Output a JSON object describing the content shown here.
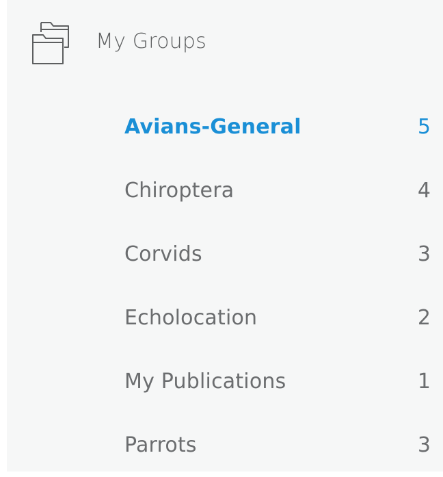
{
  "header": {
    "icon": "folders-icon",
    "title": "My Groups"
  },
  "colors": {
    "accent": "#1a8fd6",
    "text": "#6b6d6f",
    "background": "#f6f7f7"
  },
  "groups": [
    {
      "name": "Avians-General",
      "count": "5",
      "active": true
    },
    {
      "name": "Chiroptera",
      "count": "4",
      "active": false
    },
    {
      "name": "Corvids",
      "count": "3",
      "active": false
    },
    {
      "name": "Echolocation",
      "count": "2",
      "active": false
    },
    {
      "name": "My Publications",
      "count": "1",
      "active": false
    },
    {
      "name": "Parrots",
      "count": "3",
      "active": false
    }
  ]
}
